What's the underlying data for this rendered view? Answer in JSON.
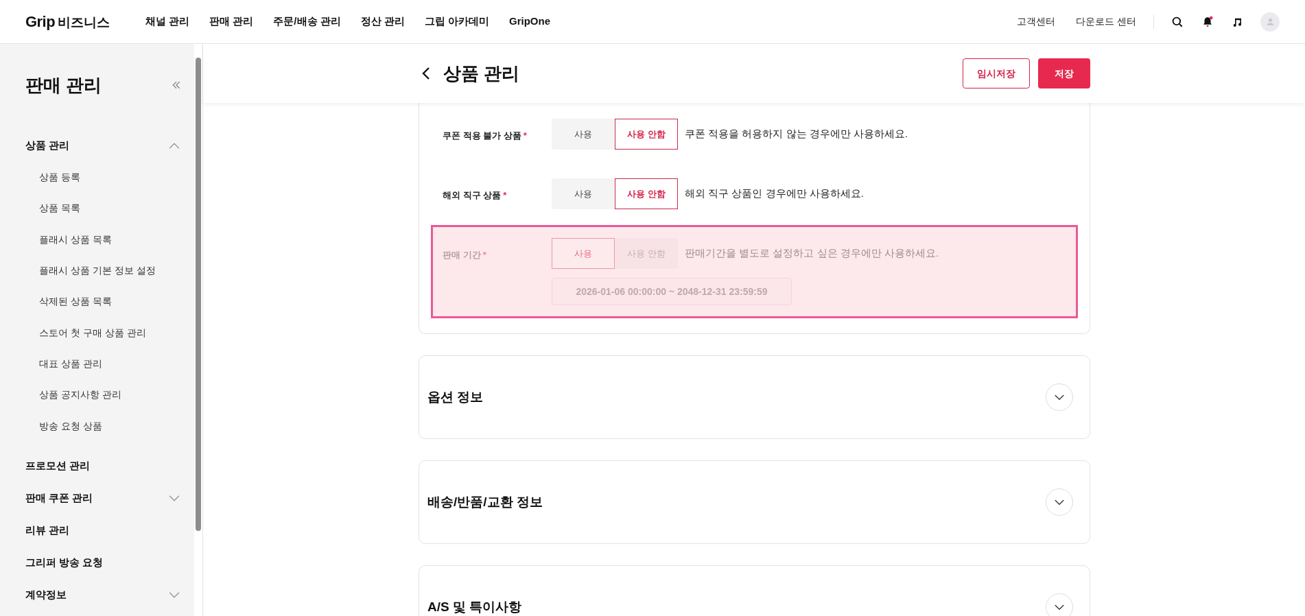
{
  "topbar": {
    "logo": "Grip",
    "logo_suffix": "비즈니스",
    "nav": [
      {
        "label": "채널 관리"
      },
      {
        "label": "판매 관리"
      },
      {
        "label": "주문/배송 관리"
      },
      {
        "label": "정산 관리"
      },
      {
        "label": "그립 아카데미"
      },
      {
        "label": "GripOne"
      }
    ],
    "links": [
      "고객센터",
      "다운로드 센터"
    ],
    "notification_dot": true
  },
  "sidebar": {
    "title": "판매 관리",
    "items": [
      {
        "label": "상품 관리",
        "expanded": true,
        "children": [
          {
            "label": "상품 등록"
          },
          {
            "label": "상품 목록"
          },
          {
            "label": "플래시 상품 목록"
          },
          {
            "label": "플래시 상품 기본 정보 설정"
          },
          {
            "label": "삭제된 상품 목록"
          },
          {
            "label": "스토어 첫 구매 상품 관리"
          },
          {
            "label": "대표 상품 관리"
          },
          {
            "label": "상품 공지사항 관리"
          },
          {
            "label": "방송 요청 상품"
          }
        ]
      },
      {
        "label": "프로모션 관리"
      },
      {
        "label": "판매 쿠폰 관리",
        "expanded": false
      },
      {
        "label": "리뷰 관리"
      },
      {
        "label": "그리퍼 방송 요청"
      },
      {
        "label": "계약정보",
        "expanded": false
      }
    ]
  },
  "header": {
    "title": "상품 관리",
    "buttons": [
      {
        "label": "임시저장",
        "kind": "outline"
      },
      {
        "label": "저장",
        "kind": "primary"
      }
    ]
  },
  "form": {
    "rows": [
      {
        "label": "쿠폰 적용 불가 상품",
        "required": "*",
        "options": [
          {
            "label": "사용",
            "selected": false
          },
          {
            "label": "사용 안함",
            "selected": true
          }
        ],
        "hint": "쿠폰 적용을 허용하지 않는 경우에만 사용하세요.",
        "highlighted": false
      },
      {
        "label": "해외 직구 상품",
        "required": "*",
        "options": [
          {
            "label": "사용",
            "selected": false
          },
          {
            "label": "사용 안함",
            "selected": true
          }
        ],
        "hint": "해외 직구 상품인 경우에만 사용하세요.",
        "highlighted": false
      },
      {
        "label": "판매 기간",
        "required": "*",
        "options": [
          {
            "label": "사용",
            "selected": true
          },
          {
            "label": "사용 안함",
            "selected": false
          }
        ],
        "hint": "판매기간을 별도로 설정하고 싶은 경우에만 사용하세요.",
        "highlighted": true,
        "date_range": "2026-01-06 00:00:00 ~ 2048-12-31 23:59:59"
      }
    ]
  },
  "sections": [
    {
      "title": "옵션 정보",
      "expanded": false
    },
    {
      "title": "배송/반품/교환 정보",
      "expanded": false
    },
    {
      "title": "A/S 및 특이사항",
      "expanded": false
    }
  ]
}
